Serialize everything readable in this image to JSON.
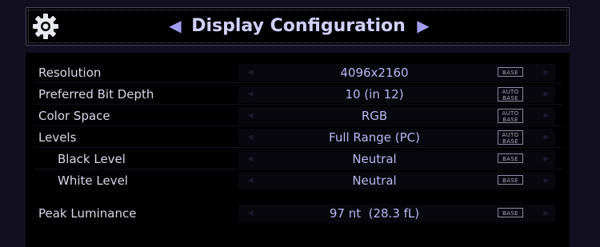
{
  "header": {
    "title": "Display Configuration",
    "prev_icon": "◀",
    "next_icon": "▶",
    "gear_icon": "gear-icon"
  },
  "settings": [
    {
      "label": "Resolution",
      "value": "4096x2160",
      "badge": [
        "BASE"
      ]
    },
    {
      "label": "Preferred Bit Depth",
      "value": "10 (in 12)",
      "badge": [
        "AUTO",
        "BASE"
      ]
    },
    {
      "label": "Color Space",
      "value": "RGB",
      "badge": [
        "AUTO",
        "BASE"
      ]
    },
    {
      "label": "Levels",
      "value": "Full Range (PC)",
      "badge": [
        "AUTO",
        "BASE"
      ]
    },
    {
      "label": "Black Level",
      "value": "Neutral",
      "badge": [
        "BASE"
      ]
    },
    {
      "label": "White Level",
      "value": "Neutral",
      "badge": [
        "BASE"
      ]
    },
    {
      "label": "Peak Luminance",
      "value": "97 nt  (28.3 fL)",
      "badge": [
        "BASE"
      ]
    }
  ],
  "colors": {
    "background": "#121020",
    "panel": "#000000",
    "title": "#cfd0ff",
    "accent_arrow": "#9e9df0",
    "value_text": "#b6b8f0"
  }
}
